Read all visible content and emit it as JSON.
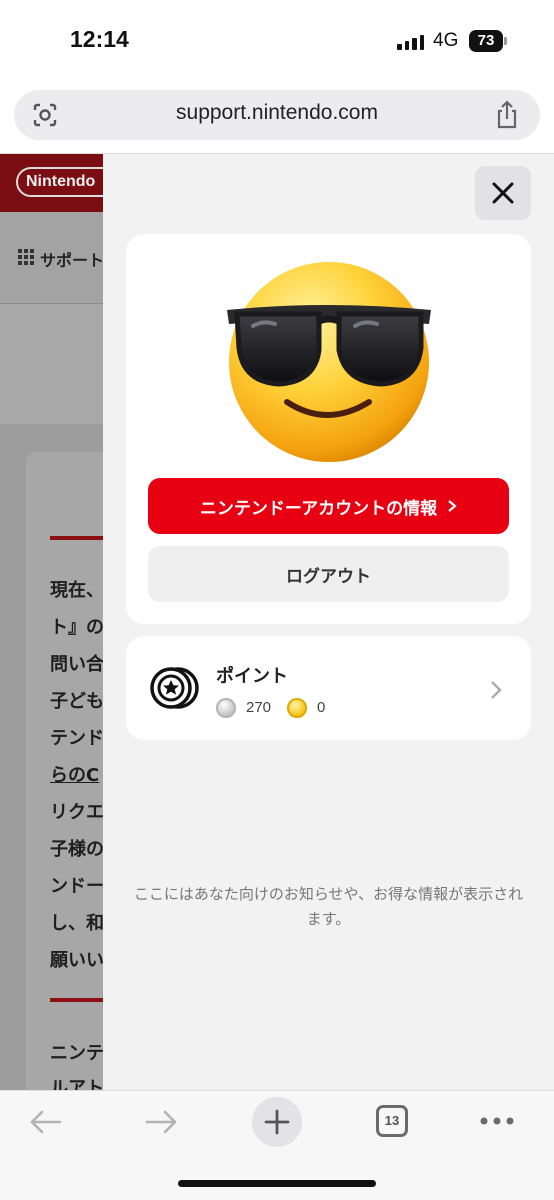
{
  "status_bar": {
    "time": "12:14",
    "network": "4G",
    "battery": "73"
  },
  "browser": {
    "url": "support.nintendo.com",
    "tab_count": "13"
  },
  "background_page": {
    "logo": "Nintendo",
    "nav_label": "サポート",
    "text_lines": [
      "現在、",
      "ト』の",
      "問い合",
      "子ども",
      "テンド",
      "らのC",
      "リクエ",
      "子様の",
      "ンドー",
      "し、和",
      "願いい",
      "ニンテ",
      "ルアト"
    ]
  },
  "panel": {
    "account_button": "ニンテンドーアカウントの情報",
    "logout_button": "ログアウト",
    "points": {
      "title": "ポイント",
      "platinum": "270",
      "gold": "0"
    },
    "notice": "ここにはあなた向けのお知らせや、お得な情報が表示されます。"
  },
  "colors": {
    "nintendo_red": "#e60012",
    "panel_bg": "#f2f2f3"
  }
}
